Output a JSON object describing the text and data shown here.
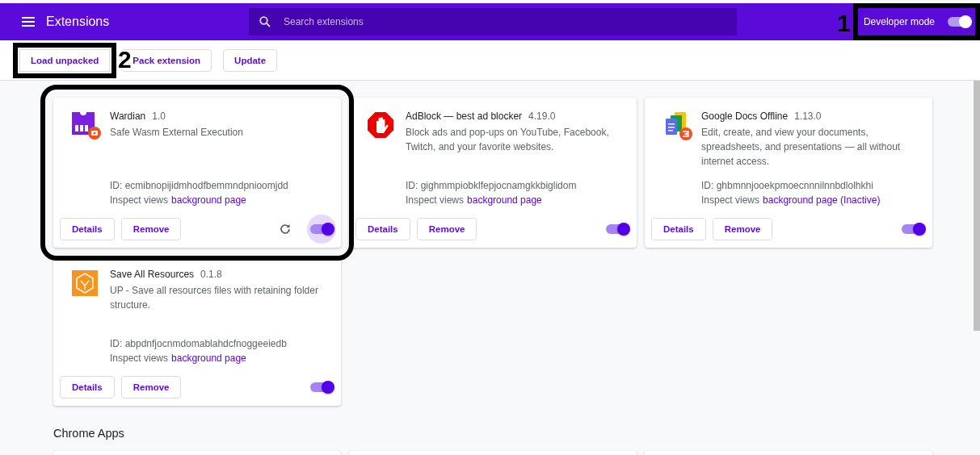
{
  "header": {
    "title": "Extensions",
    "search": {
      "placeholder": "Search extensions"
    },
    "developer_mode": {
      "label": "Developer mode",
      "on": true,
      "highlighted": true,
      "step": "1"
    }
  },
  "toolbar": {
    "buttons": [
      {
        "label": "Load unpacked",
        "highlighted": true,
        "step": "2"
      },
      {
        "label": "Pack extension",
        "highlighted": false
      },
      {
        "label": "Update",
        "highlighted": false
      }
    ]
  },
  "extensions": [
    {
      "name": "Wardian",
      "version": "1.0",
      "description": "Safe Wasm External Execution",
      "id": "ID: ecmibnopijidmhodfbemmndpnioomjdd",
      "inspect_label": "Inspect views",
      "inspect_link": "background page",
      "details": "Details",
      "remove": "Remove",
      "reload_button": true,
      "on": true,
      "focused": true,
      "highlighted": true
    },
    {
      "name": "AdBlock — best ad blocker",
      "version": "4.19.0",
      "description": "Block ads and pop-ups on YouTube, Facebook, Twitch, and your favorite websites.",
      "id": "ID: gighmmpiobklfepjocnamgkkbiglidom",
      "inspect_label": "Inspect views",
      "inspect_link": "background page",
      "details": "Details",
      "remove": "Remove",
      "reload_button": false,
      "on": true,
      "focused": false,
      "highlighted": false
    },
    {
      "name": "Google Docs Offline",
      "version": "1.13.0",
      "description": "Edit, create, and view your documents, spreadsheets, and presentations — all without internet access.",
      "id": "ID: ghbmnnjooekpmoecnnnilnnbdlolhkhi",
      "inspect_label": "Inspect views",
      "inspect_link": "background page (Inactive)",
      "details": "Details",
      "remove": "Remove",
      "reload_button": false,
      "on": true,
      "focused": false,
      "highlighted": false
    },
    {
      "name": "Save All Resources",
      "version": "0.1.8",
      "description": "UP - Save all resources files with retaining folder structure.",
      "id": "ID: abpdnfjocnmdomablahdcfnoggeeiedb",
      "inspect_label": "Inspect views",
      "inspect_link": "background page",
      "details": "Details",
      "remove": "Remove",
      "reload_button": false,
      "on": true,
      "focused": false,
      "highlighted": false
    }
  ],
  "apps_section": {
    "title": "Chrome Apps"
  }
}
